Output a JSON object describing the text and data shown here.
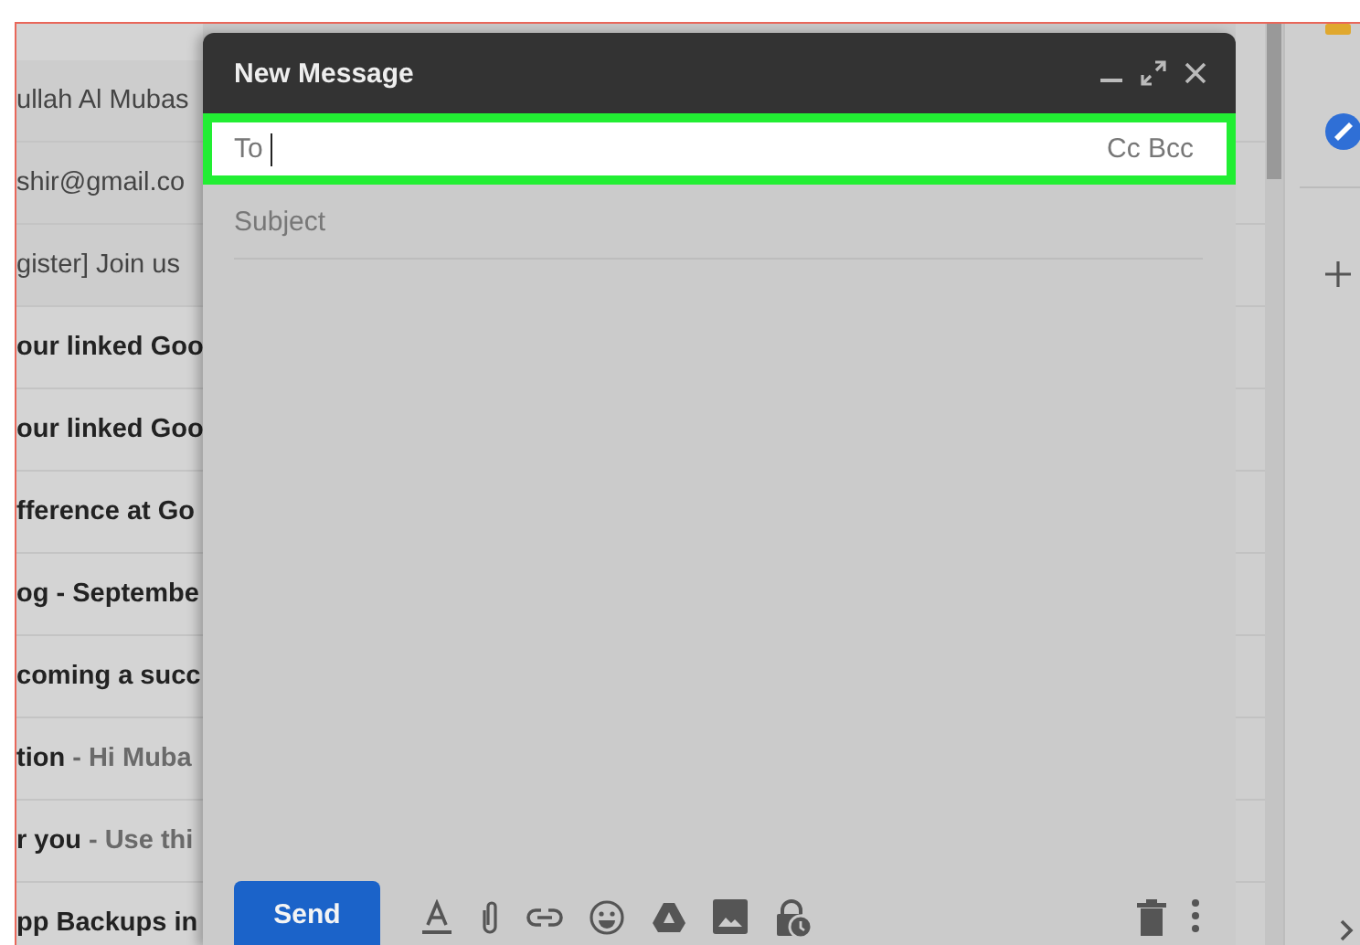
{
  "inbox": {
    "rows": [
      {
        "text": "ullah Al Mubas",
        "unread": false
      },
      {
        "text": "shir@gmail.co",
        "unread": false
      },
      {
        "text": "gister] Join us",
        "unread": false
      },
      {
        "text": "our linked Goo",
        "unread": true
      },
      {
        "text": "our linked Goo",
        "unread": true
      },
      {
        "text": "fference at Go",
        "unread": true
      },
      {
        "text": "og - Septembe",
        "unread": true
      },
      {
        "text": "coming a succ",
        "unread": true
      },
      {
        "text": "tion",
        "snippet": " - Hi Muba",
        "unread": true
      },
      {
        "text": "r you",
        "snippet": " - Use thi",
        "unread": true
      },
      {
        "text": "pp Backups in",
        "unread": true
      }
    ]
  },
  "compose": {
    "title": "New Message",
    "to": {
      "label": "To",
      "highlighted": true
    },
    "cc_bcc": "Cc Bcc",
    "subject": {
      "placeholder": "Subject"
    },
    "send": "Send"
  }
}
